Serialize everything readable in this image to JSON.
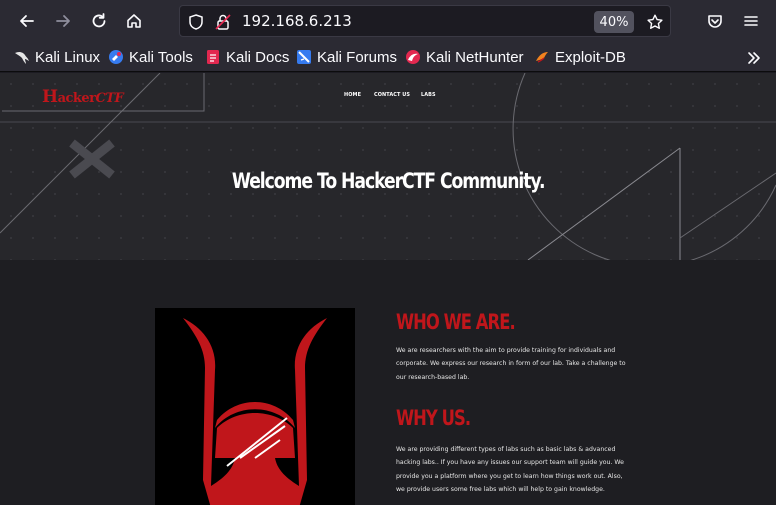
{
  "browser": {
    "url": "192.168.6.213",
    "zoom": "40%",
    "bookmarks": [
      {
        "label": "Kali Linux",
        "icon": "kali-dragon-icon"
      },
      {
        "label": "Kali Tools",
        "icon": "kali-tools-icon"
      },
      {
        "label": "Kali Docs",
        "icon": "kali-docs-icon"
      },
      {
        "label": "Kali Forums",
        "icon": "kali-forums-icon"
      },
      {
        "label": "Kali NetHunter",
        "icon": "nethunter-icon"
      },
      {
        "label": "Exploit-DB",
        "icon": "exploit-db-icon"
      }
    ]
  },
  "site": {
    "logo_initial": "H",
    "logo_rest": "acker",
    "logo_suffix": "CTF",
    "nav": [
      "HOME",
      "CONTACT US",
      "LABS"
    ],
    "hero_title": "Welcome To HackerCTF Community.",
    "who_title": "WHO WE ARE.",
    "who_text": "We are researchers with the aim to provide training for individuals and corporate. We express our research in form of our lab. Take a challenge to our research-based lab.",
    "why_title": "WHY US.",
    "why_text": "We are providing different types of labs such as basic labs & advanced hacking labs.. If you have any issues our support team will guide you. We provide you a platform where you get to learn how things work out. Also, we provide users some free labs which will help to gain knowledge."
  },
  "colors": {
    "accent": "#c0161b",
    "hero_bg": "#27272b",
    "content_bg": "#1e1e22"
  }
}
